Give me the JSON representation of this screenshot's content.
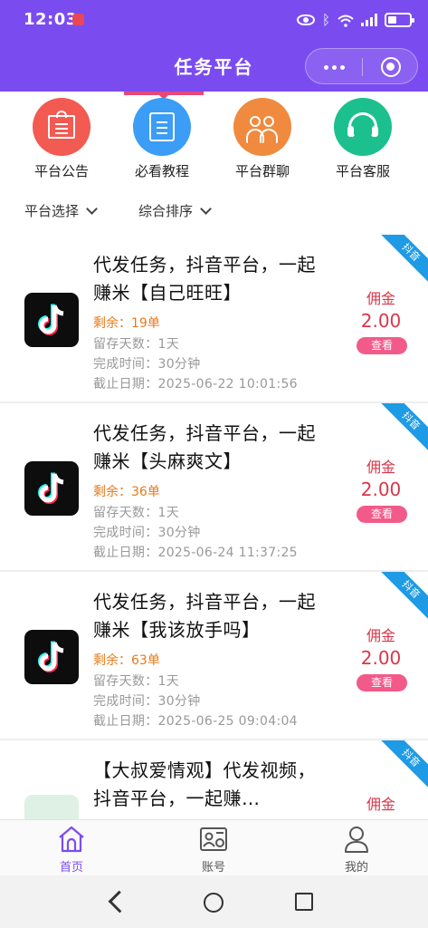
{
  "status_bar": {
    "time": "12:03",
    "network": "4G"
  },
  "header": {
    "title": "任务平台"
  },
  "nav_grid": [
    {
      "label": "平台公告",
      "icon": "notice-board-icon",
      "color": "#f25a52"
    },
    {
      "label": "必看教程",
      "icon": "tutorial-book-icon",
      "color": "#3b9df5"
    },
    {
      "label": "平台群聊",
      "icon": "group-chat-icon",
      "color": "#f08a3e"
    },
    {
      "label": "平台客服",
      "icon": "customer-service-headset-icon",
      "color": "#1bc08e"
    }
  ],
  "filters": {
    "platform": "平台选择",
    "sort": "综合排序"
  },
  "tasks": [
    {
      "ribbon": "抖音",
      "title": "代发任务，抖音平台，一起赚米【自己旺旺】",
      "remain": "剩余：19单",
      "stay_days": "留存天数：1天",
      "finish_time": "完成时间：30分钟",
      "deadline": "截止日期：2025-06-22 10:01:56",
      "commission_label": "佣金",
      "commission_value": "2.00",
      "view_label": "查看"
    },
    {
      "ribbon": "抖音",
      "title": "代发任务，抖音平台，一起赚米【头麻爽文】",
      "remain": "剩余：36单",
      "stay_days": "留存天数：1天",
      "finish_time": "完成时间：30分钟",
      "deadline": "截止日期：2025-06-24 11:37:25",
      "commission_label": "佣金",
      "commission_value": "2.00",
      "view_label": "查看"
    },
    {
      "ribbon": "抖音",
      "title": "代发任务，抖音平台，一起赚米【我该放手吗】",
      "remain": "剩余：63单",
      "stay_days": "留存天数：1天",
      "finish_time": "完成时间：30分钟",
      "deadline": "截止日期：2025-06-25 09:04:04",
      "commission_label": "佣金",
      "commission_value": "2.00",
      "view_label": "查看"
    },
    {
      "ribbon": "抖音",
      "title": "【大叔爱情观】代发视频，抖音平台，一起赚…",
      "commission_label": "佣金"
    }
  ],
  "tabbar": [
    {
      "label": "首页",
      "icon": "home-icon",
      "active": true
    },
    {
      "label": "账号",
      "icon": "account-card-icon",
      "active": false
    },
    {
      "label": "我的",
      "icon": "profile-icon",
      "active": false
    }
  ],
  "colors": {
    "primary": "#7a4cf0",
    "commission": "#d8374a",
    "view_button": "#f25a8a",
    "ribbon": "#1e9be4",
    "remain": "#e87a1c"
  }
}
